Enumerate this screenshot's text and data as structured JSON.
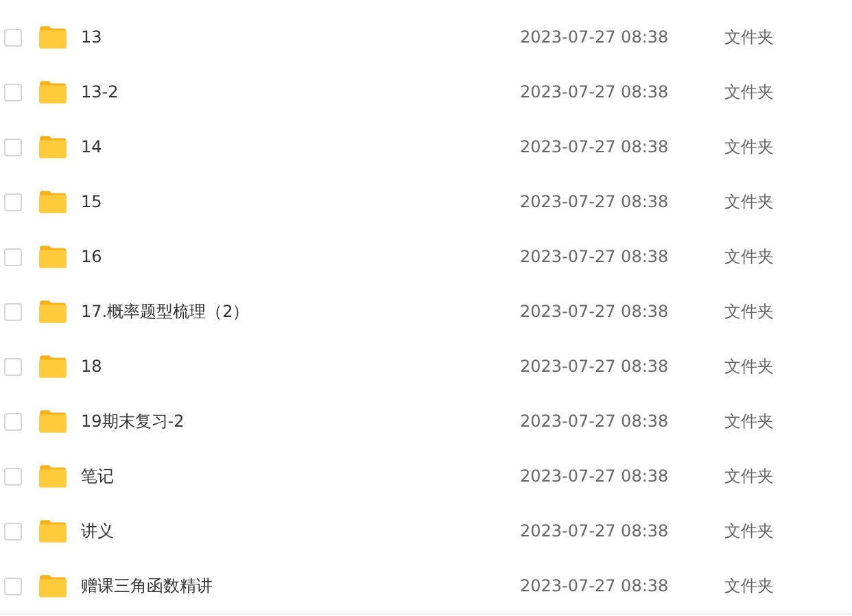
{
  "files": [
    {
      "name": "13",
      "modified": "2023-07-27 08:38",
      "type": "文件夹",
      "checked": false
    },
    {
      "name": "13-2",
      "modified": "2023-07-27 08:38",
      "type": "文件夹",
      "checked": false
    },
    {
      "name": "14",
      "modified": "2023-07-27 08:38",
      "type": "文件夹",
      "checked": false
    },
    {
      "name": "15",
      "modified": "2023-07-27 08:38",
      "type": "文件夹",
      "checked": false
    },
    {
      "name": "16",
      "modified": "2023-07-27 08:38",
      "type": "文件夹",
      "checked": false
    },
    {
      "name": "17.概率题型梳理（2）",
      "modified": "2023-07-27 08:38",
      "type": "文件夹",
      "checked": false
    },
    {
      "name": "18",
      "modified": "2023-07-27 08:38",
      "type": "文件夹",
      "checked": false
    },
    {
      "name": "19期末复习-2",
      "modified": "2023-07-27 08:38",
      "type": "文件夹",
      "checked": false
    },
    {
      "name": "笔记",
      "modified": "2023-07-27 08:38",
      "type": "文件夹",
      "checked": false
    },
    {
      "name": "讲义",
      "modified": "2023-07-27 08:38",
      "type": "文件夹",
      "checked": false
    },
    {
      "name": "赠课三角函数精讲",
      "modified": "2023-07-27 08:38",
      "type": "文件夹",
      "checked": false
    }
  ]
}
